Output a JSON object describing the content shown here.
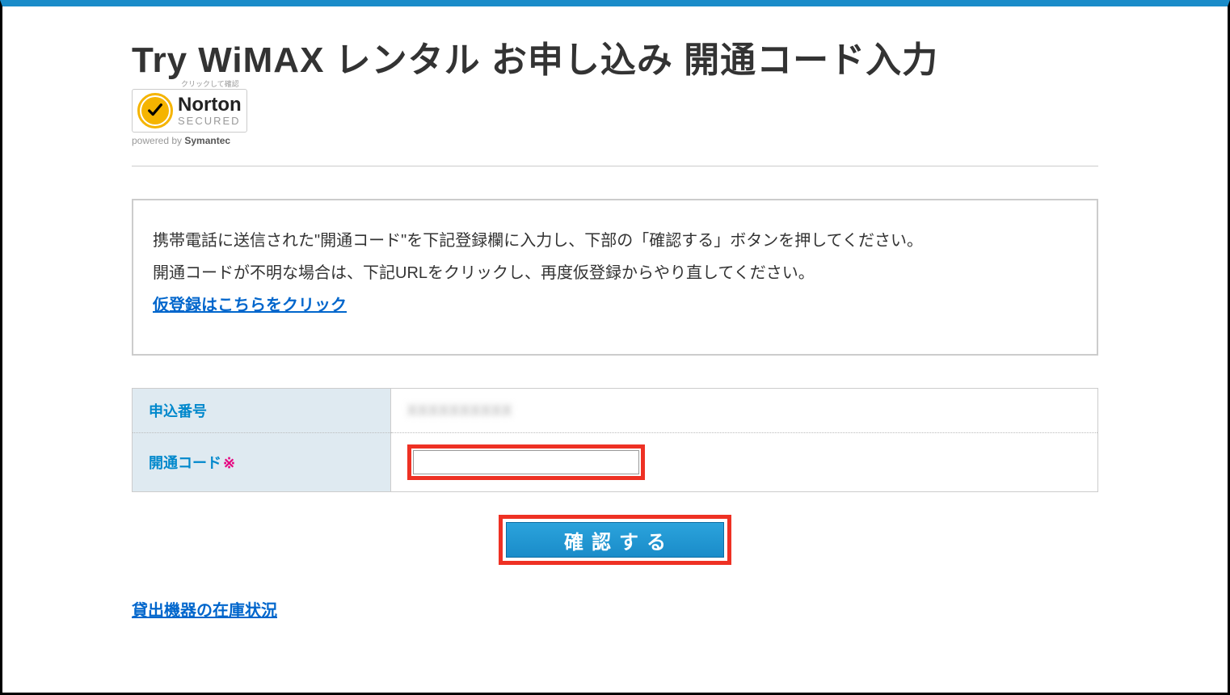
{
  "page": {
    "title": "Try WiMAX レンタル お申し込み 開通コード入力"
  },
  "norton": {
    "click_text": "クリックして確認",
    "brand": "Norton",
    "secured": "SECURED",
    "powered_prefix": "powered by ",
    "powered_brand": "Symantec"
  },
  "instructions": {
    "line1": "携帯電話に送信された\"開通コード\"を下記登録欄に入力し、下部の「確認する」ボタンを押してください。",
    "line2": "開通コードが不明な場合は、下記URLをクリックし、再度仮登録からやり直してください。",
    "link_text": "仮登録はこちらをクリック"
  },
  "form": {
    "application_number_label": "申込番号",
    "application_number_value": "XXXXXXXXXX",
    "code_label": "開通コード",
    "required_mark": "※",
    "code_value": ""
  },
  "buttons": {
    "confirm": "確認する"
  },
  "links": {
    "stock_status": "貸出機器の在庫状況"
  }
}
